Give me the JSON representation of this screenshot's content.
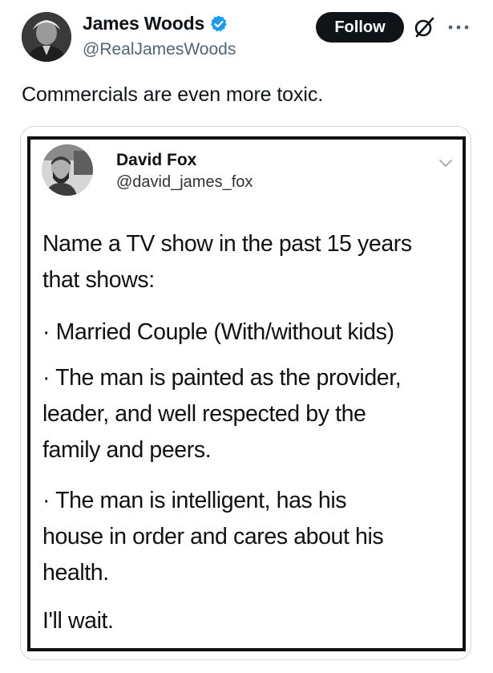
{
  "tweet": {
    "author_name": "James Woods",
    "author_handle": "@RealJamesWoods",
    "follow_label": "Follow",
    "text": "Commercials are even more toxic.",
    "accent_color": "#1d9bf0",
    "icons": [
      "verified-badge-icon",
      "grok-icon",
      "more-icon"
    ]
  },
  "quoted_image": {
    "author_name": "David Fox",
    "author_handle": "@david_james_fox",
    "paragraphs": [
      {
        "line1": "Name a TV show in the past 15 years",
        "line2": "that shows:"
      },
      {
        "line1": "· Married Couple (With/without kids)"
      },
      {
        "line1": "· The man is painted as the provider,",
        "line2": "leader, and well respected by the",
        "line3": "family and peers."
      },
      {
        "line1": "· The man is intelligent, has his",
        "line2": "house in order and cares about his",
        "line3": "health."
      },
      {
        "line1": "I'll wait."
      }
    ]
  }
}
